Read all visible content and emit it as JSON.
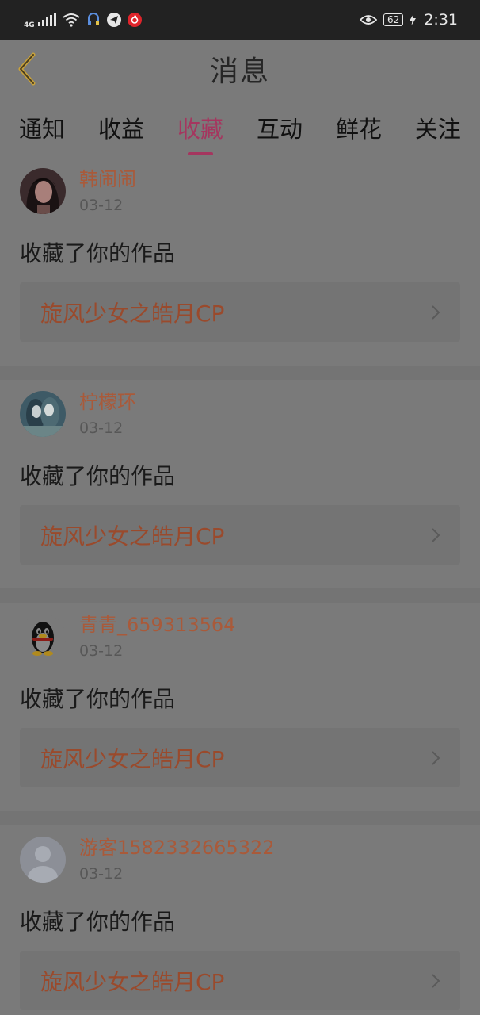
{
  "status_bar": {
    "network": "4G",
    "battery": "62",
    "time": "2:31",
    "icons": [
      "signal-icon",
      "wifi-icon",
      "headset-icon",
      "telegram-icon",
      "netease-music-icon",
      "eye-icon",
      "charging-icon"
    ]
  },
  "header": {
    "title": "消息",
    "back_icon": "chevron-left-icon"
  },
  "tabs": [
    {
      "label": "通知",
      "active": false
    },
    {
      "label": "收益",
      "active": false
    },
    {
      "label": "收藏",
      "active": true
    },
    {
      "label": "互动",
      "active": false
    },
    {
      "label": "鲜花",
      "active": false
    },
    {
      "label": "关注",
      "active": false
    }
  ],
  "colors": {
    "accent": "#a5365f",
    "username": "#a95a3a",
    "work_title": "#9a4a2c"
  },
  "messages": [
    {
      "username": "韩闹闹",
      "date": "03-12",
      "action": "收藏了你的作品",
      "work_title": "旋风少女之皓月CP",
      "avatar": "photo-avatar"
    },
    {
      "username": "柠檬环",
      "date": "03-12",
      "action": "收藏了你的作品",
      "work_title": "旋风少女之皓月CP",
      "avatar": "anime-avatar"
    },
    {
      "username": "青青_659313564",
      "date": "03-12",
      "action": "收藏了你的作品",
      "work_title": "旋风少女之皓月CP",
      "avatar": "qq-penguin-avatar"
    },
    {
      "username": "游客1582332665322",
      "date": "03-12",
      "action": "收藏了你的作品",
      "work_title": "旋风少女之皓月CP",
      "avatar": "default-avatar"
    }
  ]
}
